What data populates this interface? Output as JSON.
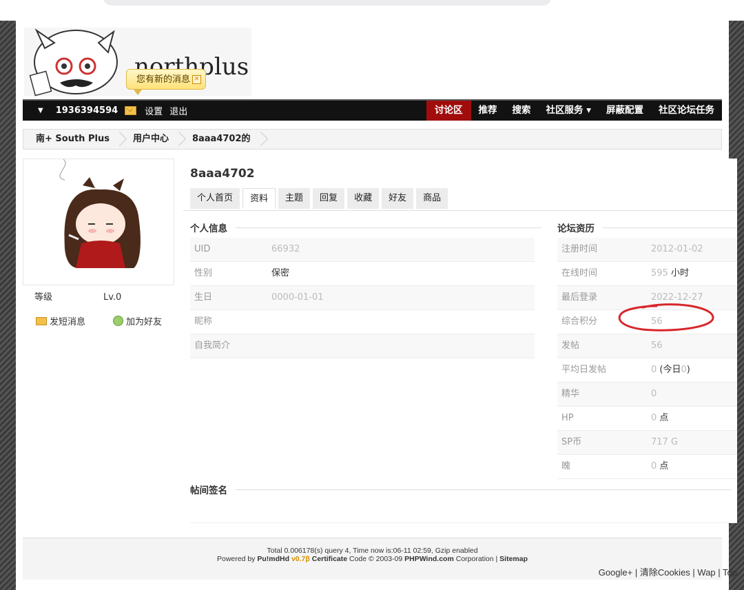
{
  "header": {
    "bubble_text": "您有新的消息",
    "nav": {
      "username": "1936394594",
      "settings": "设置",
      "logout": "退出",
      "items": [
        {
          "label": "讨论区"
        },
        {
          "label": "推荐"
        },
        {
          "label": "搜索"
        },
        {
          "label": "社区服务 ▾"
        },
        {
          "label": "屏蔽配置"
        },
        {
          "label": "社区论坛任务"
        }
      ],
      "active_index": 0,
      "active_color": "#a10d0d"
    }
  },
  "breadcrumb": [
    "南+ South Plus",
    "用户中心",
    "8aaa4702的"
  ],
  "sidebar": {
    "level_label": "等级",
    "level_value": "Lv.0",
    "send_msg": "发短消息",
    "add_friend": "加为好友"
  },
  "profile": {
    "username": "8aaa4702",
    "tabs": [
      "个人首页",
      "资料",
      "主题",
      "回复",
      "收藏",
      "好友",
      "商品"
    ],
    "active_tab": 1,
    "personal": {
      "title": "个人信息",
      "rows": [
        {
          "k": "UID",
          "v": "66932"
        },
        {
          "k": "性别",
          "v": "保密"
        },
        {
          "k": "生日",
          "v": "0000-01-01"
        },
        {
          "k": "昵称",
          "v": ""
        },
        {
          "k": "自我简介",
          "v": ""
        }
      ]
    },
    "forum": {
      "title": "论坛资历",
      "rows": [
        {
          "k": "注册时间",
          "v": "2012-01-02",
          "unit": ""
        },
        {
          "k": "在线时间",
          "v": "595",
          "unit": " 小时"
        },
        {
          "k": "最后登录",
          "v": "2022-12-27",
          "unit": ""
        },
        {
          "k": "综合积分",
          "v": "56",
          "unit": ""
        },
        {
          "k": "发帖",
          "v": "56",
          "unit": ""
        },
        {
          "k": "平均日发帖",
          "v": "0",
          "unit": " (今日",
          "v2": "0",
          "unit2": ")"
        },
        {
          "k": "精华",
          "v": "0",
          "unit": ""
        },
        {
          "k": "HP",
          "v": "0",
          "unit": " 点"
        },
        {
          "k": "SP币",
          "v": "717 G",
          "unit": ""
        },
        {
          "k": "魄",
          "v": "0",
          "unit": " 点"
        }
      ]
    },
    "signature_title": "帖间签名"
  },
  "footer": {
    "line1": "Total 0.006178(s) query 4, Time now is:06-11 02:59, Gzip enabled",
    "powered_prefix": "Powered by ",
    "product": "Pu!mdHd",
    "version": "v0.7β",
    "certificate": "Certificate",
    "code_text": " Code © 2003-09 ",
    "phpwind": "PHPWind.com",
    "corp": " Corporation | ",
    "sitemap": "Sitemap",
    "links": [
      "Google+",
      "清除Cookies",
      "Wap",
      "Top"
    ]
  }
}
